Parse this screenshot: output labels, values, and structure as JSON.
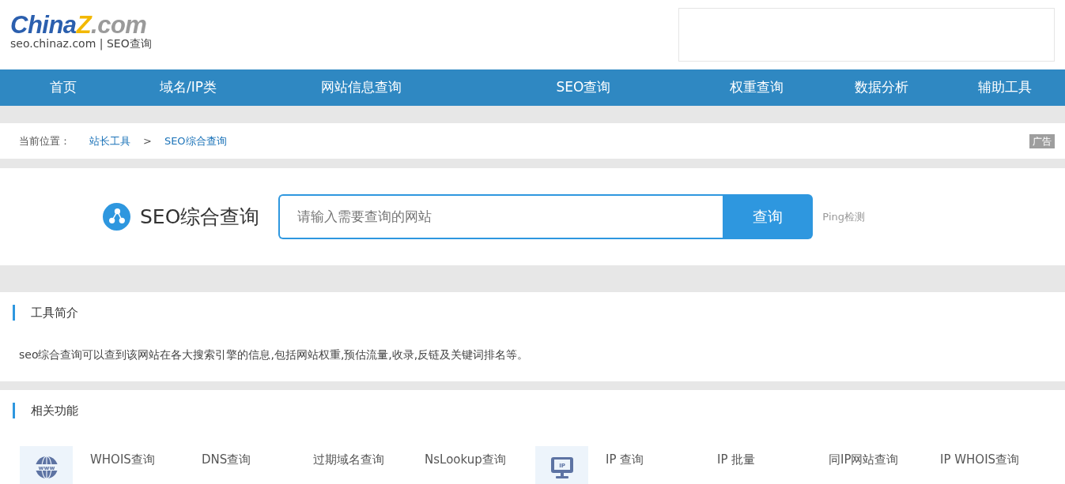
{
  "header": {
    "logo": {
      "brand_main": "China",
      "brand_z": "Z",
      "brand_tail": ".com",
      "subtitle_site": "seo.chinaz.com",
      "subtitle_divider": "|",
      "subtitle_name": "SEO查询"
    }
  },
  "nav": {
    "items": [
      {
        "label": "首页"
      },
      {
        "label": "域名/IP类"
      },
      {
        "label": "网站信息查询"
      },
      {
        "label": "SEO查询"
      },
      {
        "label": "权重查询"
      },
      {
        "label": "数据分析"
      },
      {
        "label": "辅助工具"
      }
    ]
  },
  "breadcrumb": {
    "prefix": "当前位置：",
    "links": [
      {
        "label": "站长工具"
      },
      {
        "label": "SEO综合查询"
      }
    ],
    "separator": ">",
    "ad_badge": "广告"
  },
  "search": {
    "title": "SEO综合查询",
    "placeholder": "请输入需要查询的网站",
    "button": "查询",
    "extra_link": "Ping检测"
  },
  "intro": {
    "heading": "工具简介",
    "text": "seo综合查询可以查到该网站在各大搜索引擎的信息,包括网站权重,预估流量,收录,反链及关键词排名等。"
  },
  "related": {
    "heading": "相关功能",
    "groups": [
      {
        "kind": "www",
        "links": [
          "WHOIS查询",
          "DNS查询",
          "过期域名查询",
          "NsLookup查询"
        ]
      },
      {
        "kind": "ip",
        "icon_text": "IP",
        "links": [
          "IP 查询",
          "IP 批量",
          "同IP网站查询",
          "IP WHOIS查询"
        ]
      }
    ]
  }
}
